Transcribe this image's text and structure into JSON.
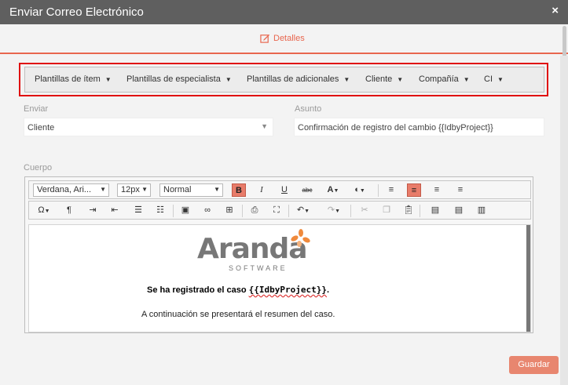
{
  "window": {
    "title": "Enviar Correo Electrónico",
    "close_glyph": "×"
  },
  "tabs": [
    {
      "label": "Detalles",
      "icon": "edit-icon",
      "active": true
    }
  ],
  "templates": [
    {
      "label": "Plantillas de ítem"
    },
    {
      "label": "Plantillas de especialista"
    },
    {
      "label": "Plantillas de adicionales"
    },
    {
      "label": "Cliente"
    },
    {
      "label": "Compañía"
    },
    {
      "label": "CI"
    }
  ],
  "form": {
    "send_label": "Enviar",
    "send_value": "Cliente",
    "subject_label": "Asunto",
    "subject_value": "Confirmación de registro del cambio {{IdbyProject}}",
    "body_label": "Cuerpo"
  },
  "editor": {
    "font_family": "Verdana, Ari...",
    "font_size": "12px",
    "format": "Normal",
    "toolbar_row1": [
      "B",
      "I",
      "U",
      "abc",
      "A",
      "◐",
      "≡",
      "≡",
      "≡",
      "≡"
    ],
    "symbols_glyph": "Ω",
    "para_glyph": "¶",
    "logo_word": "Aranda",
    "logo_sub": "SOFTWARE",
    "content_line1_prefix": "Se ha registrado el caso ",
    "content_line1_var": "{{IdbyProject}}",
    "content_line1_suffix": ".",
    "content_line2": "A continuación se presentará el resumen del caso."
  },
  "buttons": {
    "save": "Guardar"
  },
  "colors": {
    "accent": "#e8664e",
    "highlight": "#e01010",
    "titlebar": "#5f5f5f",
    "logo_orange": "#f08a3c"
  }
}
